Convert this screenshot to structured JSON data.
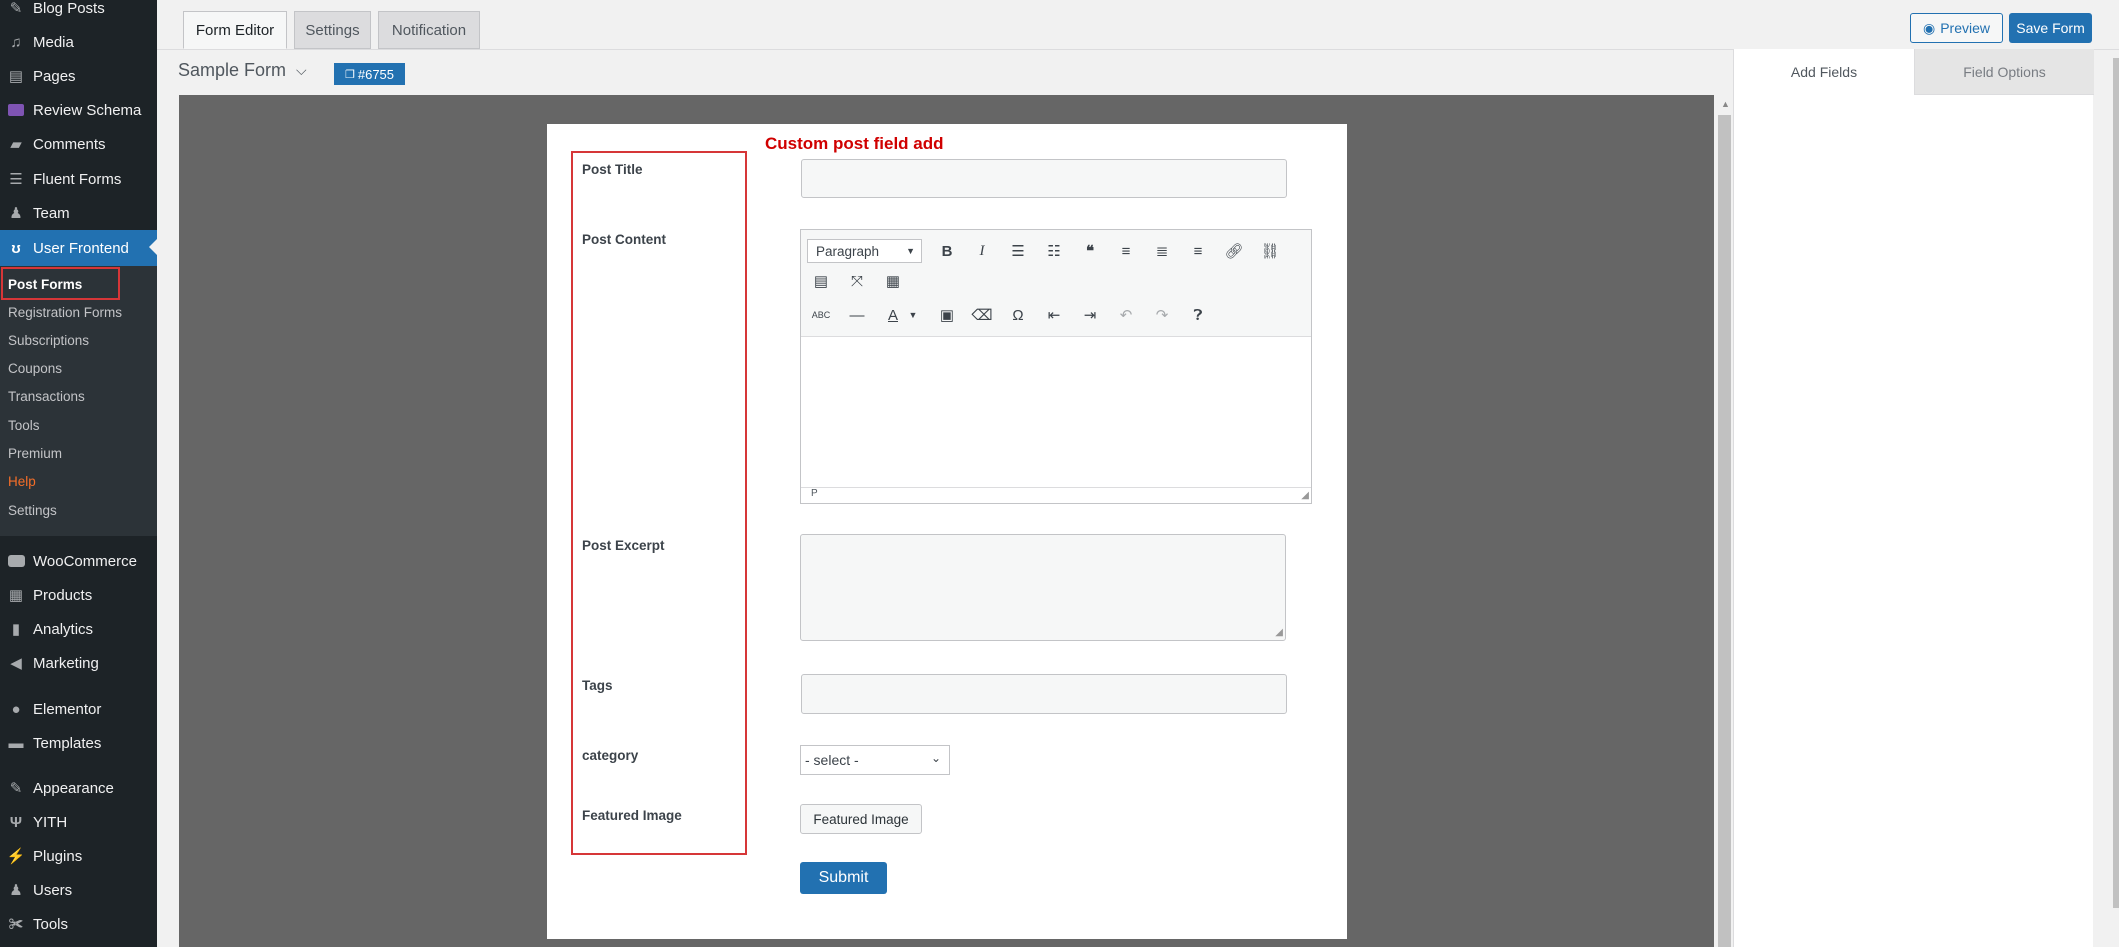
{
  "sidebar": {
    "menu": [
      {
        "label": "Blog Posts",
        "icon": "pin-icon"
      },
      {
        "label": "Media",
        "icon": "media-icon"
      },
      {
        "label": "Pages",
        "icon": "pages-icon"
      },
      {
        "label": "Review Schema",
        "icon": "review-icon"
      },
      {
        "label": "Comments",
        "icon": "comments-icon"
      },
      {
        "label": "Fluent Forms",
        "icon": "forms-icon"
      },
      {
        "label": "Team",
        "icon": "team-icon"
      },
      {
        "label": "User Frontend",
        "icon": "user-frontend-icon"
      }
    ],
    "submenu": [
      {
        "label": "Post Forms"
      },
      {
        "label": "Registration Forms"
      },
      {
        "label": "Subscriptions"
      },
      {
        "label": "Coupons"
      },
      {
        "label": "Transactions"
      },
      {
        "label": "Tools"
      },
      {
        "label": "Premium"
      },
      {
        "label": "Help"
      },
      {
        "label": "Settings"
      }
    ],
    "menu_bottom": [
      {
        "label": "WooCommerce",
        "icon": "woo-icon"
      },
      {
        "label": "Products",
        "icon": "products-icon"
      },
      {
        "label": "Analytics",
        "icon": "analytics-icon"
      },
      {
        "label": "Marketing",
        "icon": "marketing-icon"
      },
      {
        "label": "Elementor",
        "icon": "elementor-icon"
      },
      {
        "label": "Templates",
        "icon": "templates-icon"
      },
      {
        "label": "Appearance",
        "icon": "appearance-icon"
      },
      {
        "label": "YITH",
        "icon": "yith-icon"
      },
      {
        "label": "Plugins",
        "icon": "plugins-icon"
      },
      {
        "label": "Users",
        "icon": "users-icon"
      },
      {
        "label": "Tools",
        "icon": "tools-icon"
      }
    ]
  },
  "tabs": [
    "Form Editor",
    "Settings",
    "Notification"
  ],
  "toolbar": {
    "preview_label": "Preview",
    "save_label": "Save Form"
  },
  "form": {
    "title": "Sample Form",
    "id_badge": "#6755"
  },
  "right_panel": {
    "tabs": [
      "Add Fields",
      "Field Options"
    ]
  },
  "annotation": "Custom post field add",
  "fields": {
    "post_title": "Post Title",
    "post_content": "Post Content",
    "post_excerpt": "Post Excerpt",
    "tags": "Tags",
    "category": "category",
    "featured_image": "Featured Image"
  },
  "editor": {
    "format_select": "Paragraph",
    "status_path": "P"
  },
  "category_select": {
    "value": "- select -"
  },
  "featured_image_button": "Featured Image",
  "submit_button": "Submit",
  "colors": {
    "accent": "#2271b1",
    "sidebar_bg": "#1d2327",
    "annotation": "#d00000",
    "canvas_bg": "#666666"
  }
}
